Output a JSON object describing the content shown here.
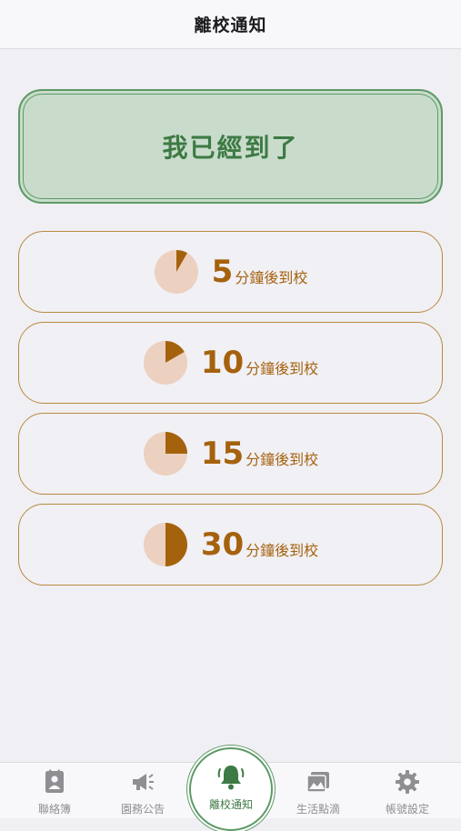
{
  "header": {
    "title": "離校通知"
  },
  "arrived": {
    "label": "我已經到了"
  },
  "eta_options": [
    {
      "minutes": "5",
      "suffix": "分鐘後到校",
      "fraction": 0.0833
    },
    {
      "minutes": "10",
      "suffix": "分鐘後到校",
      "fraction": 0.1667
    },
    {
      "minutes": "15",
      "suffix": "分鐘後到校",
      "fraction": 0.25
    },
    {
      "minutes": "30",
      "suffix": "分鐘後到校",
      "fraction": 0.5
    }
  ],
  "tabs": [
    {
      "label": "聯絡簿",
      "icon": "contact-book-icon"
    },
    {
      "label": "園務公告",
      "icon": "megaphone-icon"
    },
    {
      "label": "離校通知",
      "icon": "bell-icon"
    },
    {
      "label": "生活點滴",
      "icon": "photos-icon"
    },
    {
      "label": "帳號設定",
      "icon": "gear-icon"
    }
  ],
  "colors": {
    "accent_green": "#3d7a44",
    "green_fill": "#c9dccb",
    "accent_brown": "#a5620d",
    "pie_bg": "#ecd0c0"
  }
}
